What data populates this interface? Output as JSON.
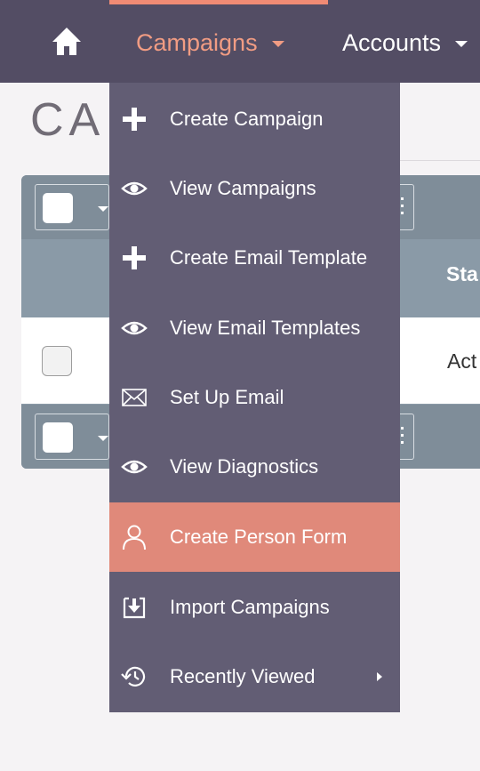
{
  "nav": {
    "campaigns_label": "Campaigns",
    "accounts_label": "Accounts"
  },
  "page": {
    "title": "CA"
  },
  "list": {
    "status_header": "Sta",
    "row_status": "Act"
  },
  "menu": {
    "items": [
      {
        "label": "Create Campaign",
        "icon": "plus-icon"
      },
      {
        "label": "View Campaigns",
        "icon": "eye-icon"
      },
      {
        "label": "Create Email Template",
        "icon": "plus-icon"
      },
      {
        "label": "View Email Templates",
        "icon": "eye-icon"
      },
      {
        "label": "Set Up Email",
        "icon": "envelope-icon"
      },
      {
        "label": "View Diagnostics",
        "icon": "eye-icon"
      },
      {
        "label": "Create Person Form",
        "icon": "person-icon"
      },
      {
        "label": "Import Campaigns",
        "icon": "import-icon"
      },
      {
        "label": "Recently Viewed",
        "icon": "history-icon"
      }
    ],
    "active_item": "Create Person Form"
  },
  "colors": {
    "nav_bg": "#534d64",
    "menu_bg": "#625d74",
    "accent": "#f19c83",
    "active_item_bg": "#e0897a"
  }
}
